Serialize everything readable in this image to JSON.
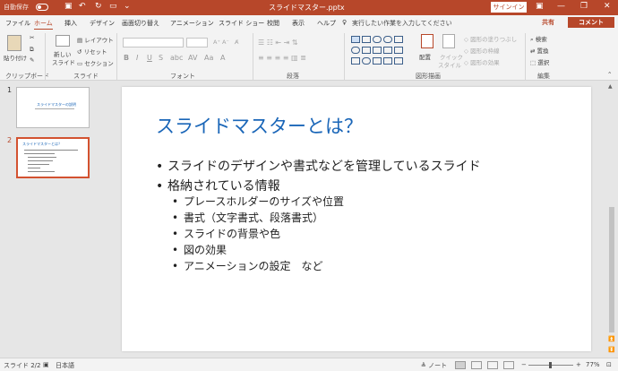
{
  "titlebar": {
    "autosave_label": "自動保存",
    "doc_title": "スライドマスター.pptx",
    "signin_label": "サインイン",
    "minimize": "—",
    "maximize": "❐",
    "close": "✕"
  },
  "tabs": [
    {
      "label": "ファイル"
    },
    {
      "label": "ホーム",
      "active": true
    },
    {
      "label": "挿入"
    },
    {
      "label": "デザイン"
    },
    {
      "label": "画面切り替え"
    },
    {
      "label": "アニメーション"
    },
    {
      "label": "スライド ショー"
    },
    {
      "label": "校閲"
    },
    {
      "label": "表示"
    },
    {
      "label": "ヘルプ"
    }
  ],
  "tellme": "実行したい作業を入力してください",
  "share_label": "共有",
  "comment_label": "コメント",
  "ribbon": {
    "clipboard": {
      "paste": "貼り付け",
      "label": "クリップボード"
    },
    "slides": {
      "new_slide": "新しい",
      "new_slide2": "スライド",
      "layout": "レイアウト",
      "reset": "リセット",
      "section": "セクション",
      "label": "スライド"
    },
    "font": {
      "label": "フォント"
    },
    "paragraph": {
      "label": "段落"
    },
    "drawing": {
      "arrange": "配置",
      "quick": "クイック",
      "quick2": "スタイル",
      "fill": "図形の塗りつぶし",
      "outline": "図形の枠線",
      "effects": "図形の効果",
      "label": "図形描画"
    },
    "editing": {
      "find": "検索",
      "replace": "置換",
      "select": "選択",
      "label": "編集"
    }
  },
  "thumbnails": [
    {
      "num": "1",
      "title": "スライドマスターの説明"
    },
    {
      "num": "2",
      "title": "スライドマスターとは？",
      "active": true
    }
  ],
  "slide": {
    "title": "スライドマスターとは？",
    "bullets": [
      {
        "level": 1,
        "text": "スライドのデザインや書式などを管理しているスライド"
      },
      {
        "level": 1,
        "text": "格納されている情報"
      },
      {
        "level": 2,
        "text": "プレースホルダーのサイズや位置"
      },
      {
        "level": 2,
        "text": "書式（文字書式、段落書式）"
      },
      {
        "level": 2,
        "text": "スライドの背景や色"
      },
      {
        "level": 2,
        "text": "図の効果"
      },
      {
        "level": 2,
        "text": "アニメーションの設定　など"
      }
    ]
  },
  "status": {
    "slide_pos": "スライド 2/2",
    "language": "日本語",
    "notes": "ノート",
    "zoom": "77%"
  },
  "colors": {
    "accent": "#b7472a",
    "title_blue": "#1a66b8"
  }
}
